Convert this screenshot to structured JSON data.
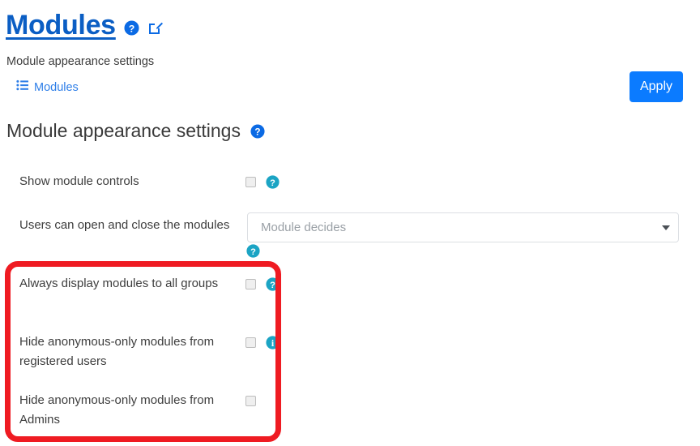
{
  "header": {
    "title": "Modules",
    "help_icon": "question-circle-icon",
    "edit_icon": "edit-pencil-icon",
    "subtitle": "Module appearance settings",
    "breadcrumb": {
      "icon": "list-icon",
      "label": "Modules"
    },
    "apply_label": "Apply"
  },
  "section": {
    "heading": "Module appearance settings",
    "help_icon": "question-circle-icon"
  },
  "settings": [
    {
      "label": "Show module controls",
      "control": "checkbox",
      "checked": false,
      "help_icon": "question-circle-icon"
    },
    {
      "label": "Users can open and close the modules",
      "control": "select",
      "value": "Module decides",
      "help_icon": "question-circle-icon"
    },
    {
      "label": "Always display modules to all groups",
      "control": "checkbox",
      "checked": false,
      "help_icon": "question-circle-icon"
    },
    {
      "label": "Hide anonymous-only modules from registered users",
      "control": "checkbox",
      "checked": false,
      "help_icon": "info-circle-icon"
    },
    {
      "label": "Hide anonymous-only modules from Admins",
      "control": "checkbox",
      "checked": false,
      "help_icon": null
    }
  ],
  "annotation": {
    "type": "highlight-rectangle",
    "color": "#ef1b22"
  },
  "colors": {
    "title_blue": "#0b5ec4",
    "link_blue": "#2f7fe8",
    "apply_blue": "#0b7bff",
    "help_teal": "#1ba4c4",
    "annotation_red": "#ef1b22"
  }
}
